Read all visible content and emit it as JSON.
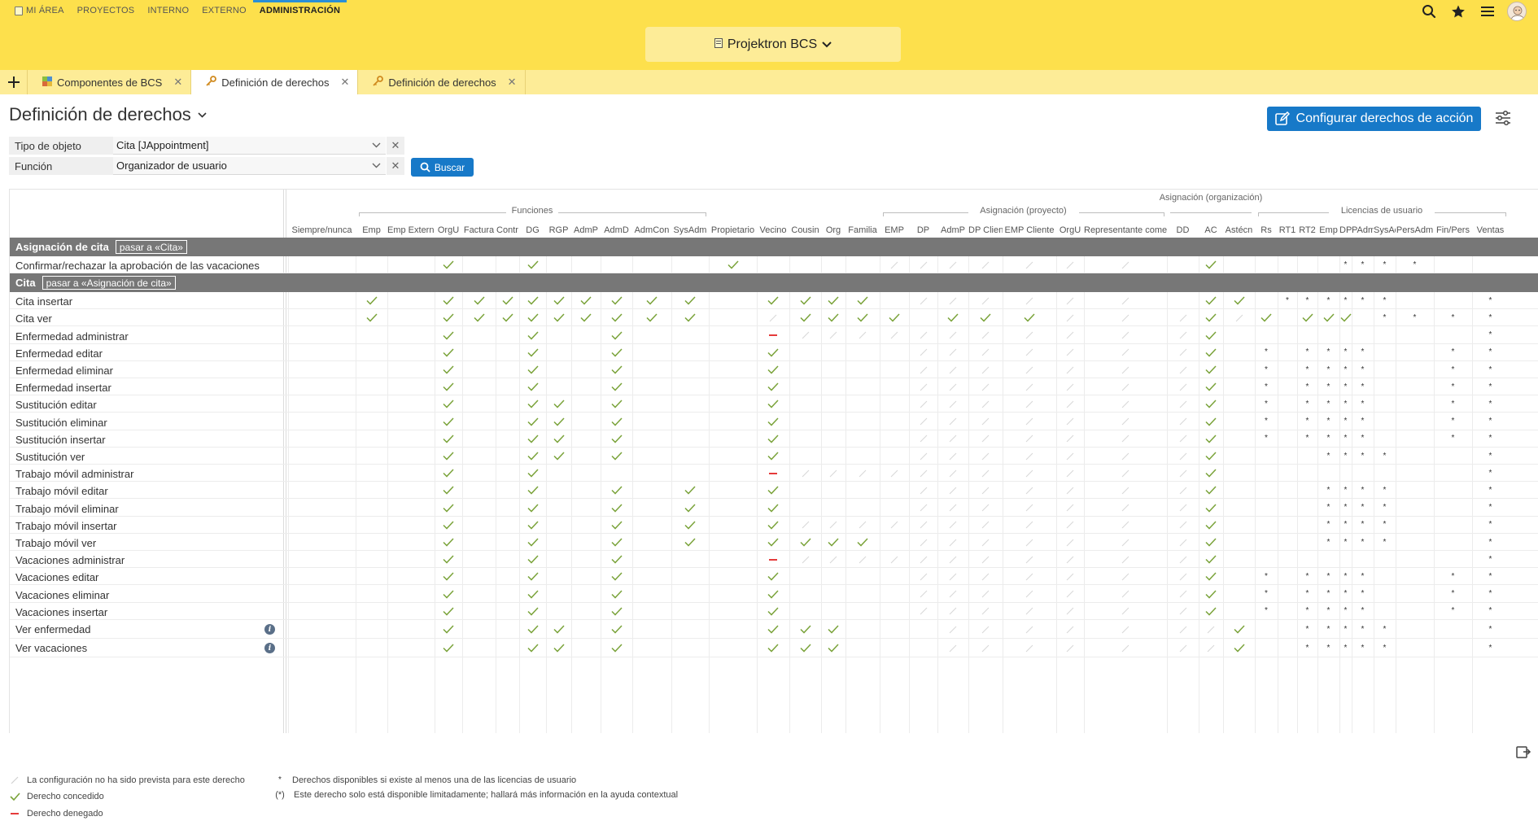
{
  "nav": {
    "items": [
      {
        "label": "MI ÁREA",
        "active": false
      },
      {
        "label": "PROYECTOS",
        "active": false
      },
      {
        "label": "INTERNO",
        "active": false
      },
      {
        "label": "EXTERNO",
        "active": false
      },
      {
        "label": "ADMINISTRACIÓN",
        "active": true
      }
    ],
    "project": "Projektron BCS",
    "icons": [
      "search-icon",
      "star-icon",
      "menu-icon",
      "avatar"
    ]
  },
  "tabs": [
    {
      "label": "Componentes de BCS",
      "icon": "component-icon",
      "active": false
    },
    {
      "label": "Definición de derechos",
      "icon": "key-icon",
      "active": true
    },
    {
      "label": "Definición de derechos",
      "icon": "key-icon",
      "active": false
    }
  ],
  "page": {
    "title": "Definición de derechos",
    "config_button": "Configurar derechos de acción"
  },
  "filter": {
    "object_type_label": "Tipo de objeto",
    "object_type_value": "Cita [JAppointment]",
    "function_label": "Función",
    "function_value": "Organizador de usuario",
    "search_button": "Buscar"
  },
  "matrix": {
    "groups": [
      {
        "label": "Funciones"
      },
      {
        "label": "Asignación (proyecto)"
      },
      {
        "label": "Asignación (organización)"
      },
      {
        "label": "Licencias de usuario"
      }
    ],
    "columns": [
      "Siempre/nunca",
      "Emp",
      "Emp External",
      "OrgU",
      "Factura",
      "Contr",
      "DG",
      "RGP",
      "AdmP",
      "AdmD",
      "AdmCon",
      "SysAdm",
      "Propietario",
      "Vecino",
      "Cousin",
      "Org",
      "Familia",
      "EMP",
      "DP",
      "AdmP",
      "DP Cliente",
      "EMP Cliente",
      "OrgU",
      "Representante comercial",
      "DD",
      "AC",
      "Astécn",
      "Rs",
      "RT1",
      "RT2",
      "Emp",
      "DP",
      "PAdm",
      "SysAdm",
      "PersAdm",
      "Fin/Pers",
      "Ventas"
    ],
    "sections": [
      {
        "title": "Asignación de cita",
        "goto": "pasar a «Cita»",
        "rows": [
          {
            "label": "Confirmar/rechazar la aprobación de las vacaciones",
            "info": false,
            "cells": "...c..c.....c............*.*....*.*.*.*.*.*.*.*.*.*.*"
          }
        ]
      },
      {
        "title": "Cita",
        "goto": "pasar a «Asignación de cita»",
        "rows": [
          {
            "label": "Cita insertar",
            "info": false
          },
          {
            "label": "Cita ver",
            "info": false
          },
          {
            "label": "Enfermedad administrar",
            "info": false
          },
          {
            "label": "Enfermedad editar",
            "info": false
          },
          {
            "label": "Enfermedad eliminar",
            "info": false
          },
          {
            "label": "Enfermedad insertar",
            "info": false
          },
          {
            "label": "Sustitución editar",
            "info": false
          },
          {
            "label": "Sustitución eliminar",
            "info": false
          },
          {
            "label": "Sustitución insertar",
            "info": false
          },
          {
            "label": "Sustitución ver",
            "info": false
          },
          {
            "label": "Trabajo móvil administrar",
            "info": false
          },
          {
            "label": "Trabajo móvil editar",
            "info": false
          },
          {
            "label": "Trabajo móvil eliminar",
            "info": false
          },
          {
            "label": "Trabajo móvil insertar",
            "info": false
          },
          {
            "label": "Trabajo móvil ver",
            "info": false
          },
          {
            "label": "Vacaciones administrar",
            "info": false
          },
          {
            "label": "Vacaciones editar",
            "info": false
          },
          {
            "label": "Vacaciones eliminar",
            "info": false
          },
          {
            "label": "Vacaciones insertar",
            "info": false
          },
          {
            "label": "Ver enfermedad",
            "info": true
          },
          {
            "label": "Ver vacaciones",
            "info": true
          }
        ]
      }
    ],
    "cells": {
      "Confirmar/rechazar la aprobación de las vacaciones": "...c..c.....c....nnnnnnn.c.....*.*.*.*...*.*.*",
      "Cita insertar": ".c.ccccccccc.cccc.nnnnnn.cc.*.*.*.*.*.*...*.*.*",
      "Cita ver": ".c.ccccccccc.ncccc.cccnnncnc.ccc.*.*.*.*.*.*...*.*.*",
      "Enfermedad administrar": "...c..c..c...dnnnnnnnnnnnc..........*.*.",
      "Enfermedad editar": "...c..c..c...c....nnnnnnnc.*..*.*.*.*...*.*.*",
      "Enfermedad eliminar": "...c..c..c...c....nnnnnnnc.*..*.*.*.*...*.*.*",
      "Enfermedad insertar": "...c..c..c...c....nnnnnnnc.*..*.*.*.*...*.*.*",
      "Sustitución editar": "...c..cc.c...c....nnnnnnnc.*..*.*.*.*...*.*.",
      "Sustitución eliminar": "...c..cc.c...c....nnnnnnnc.*..*.*.*.*...*.*.",
      "Sustitución insertar": "...c..cc.c...c....nnnnnnnc.*..*.*.*.*...*.*.",
      "Sustitución ver": "...c..cc.c...c....nnnnnnnc....*.*.*.*...*.*.*",
      "Trabajo móvil administrar": "...c..c......dnnnnnnnnnnnc..........*.*.",
      "Trabajo móvil editar": "...c..c..c.c.c....nnnnnnnc....*.*.*.*...*.*.",
      "Trabajo móvil eliminar": "...c..c..c.c.c....nnnnnnnc....*.*.*.*...*.*.",
      "Trabajo móvil insertar": "...c..c..c.c.cnnnnnnnnnnnc....*.*.*.*...*.*.",
      "Trabajo móvil ver": "...c..c..c.c.cccc.nnnnnnnc....*.*.*.*...*.*.",
      "Vacaciones administrar": "...c..c..c...dnnnnnnnnnnnc..........*.*.",
      "Vacaciones editar": "...c..c..c...c....nnnnnnnc.*..*.*.*.*...*.*.*",
      "Vacaciones eliminar": "...c..c..c...c....nnnnnnnc.*..*.*.*.*...*.*.*",
      "Vacaciones insertar": "...c..c..c...c....nnnnnnnc.*..*.*.*.*...*.*.*",
      "Ver enfermedad": "...c..cc.c...ccc...nnnnnnnc..*.*.*.*.*...*.*.*",
      "Ver vacaciones": "...c..cc.c...ccc...nnnnnnnc..*.*.*.*.*...*.*.*"
    }
  },
  "legend": {
    "not_foreseen": "La configuración no ha sido prevista para este derecho",
    "granted": "Derecho concedido",
    "denied": "Derecho denegado",
    "license_star_symbol": "*",
    "license_star": "Derechos disponibles si existe al menos una de las licencias de usuario",
    "limited_symbol": "(*)",
    "limited": "Este derecho solo está disponible limitadamente; hallará más información en la ayuda contextual"
  },
  "colors": {
    "header": "#fde04c",
    "tabstrip": "#fdec97",
    "accent": "#1779c8",
    "section": "#777777",
    "check": "#7aa33a",
    "deny": "#e53b3b"
  }
}
